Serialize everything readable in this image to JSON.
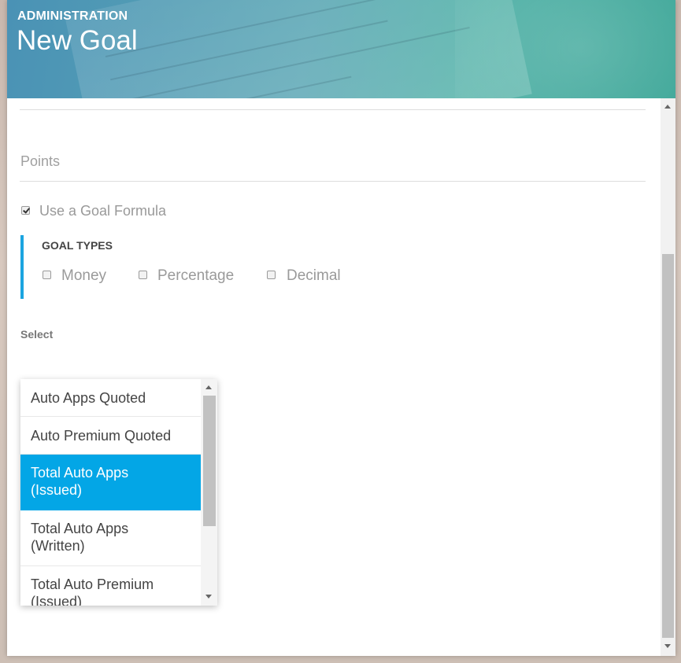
{
  "header": {
    "section": "ADMINISTRATION",
    "title": "New Goal"
  },
  "form": {
    "points_label": "Points",
    "use_formula_label": "Use a Goal Formula",
    "use_formula_checked": true,
    "goal_types": {
      "title": "GOAL TYPES",
      "options": [
        {
          "label": "Money",
          "checked": false
        },
        {
          "label": "Percentage",
          "checked": false
        },
        {
          "label": "Decimal",
          "checked": false
        }
      ]
    },
    "select_label": "Select",
    "select_options": [
      {
        "line1": "Auto Apps Quoted",
        "line2": "",
        "selected": false
      },
      {
        "line1": "Auto Premium Quoted",
        "line2": "",
        "selected": false
      },
      {
        "line1": "Total Auto Apps",
        "line2": "(Issued)",
        "selected": true
      },
      {
        "line1": "Total Auto Apps",
        "line2": "(Written)",
        "selected": false
      },
      {
        "line1": "Total Auto Premium",
        "line2": "(Issued)",
        "selected": false
      }
    ]
  },
  "icons": {
    "scroll_up": "caret-up-icon",
    "scroll_down": "caret-down-icon"
  },
  "colors": {
    "accent": "#03a6e6",
    "goal_types_bar": "#1ba4e0",
    "header_gradient_start": "#4a92b5",
    "header_gradient_end": "#3aa596"
  }
}
